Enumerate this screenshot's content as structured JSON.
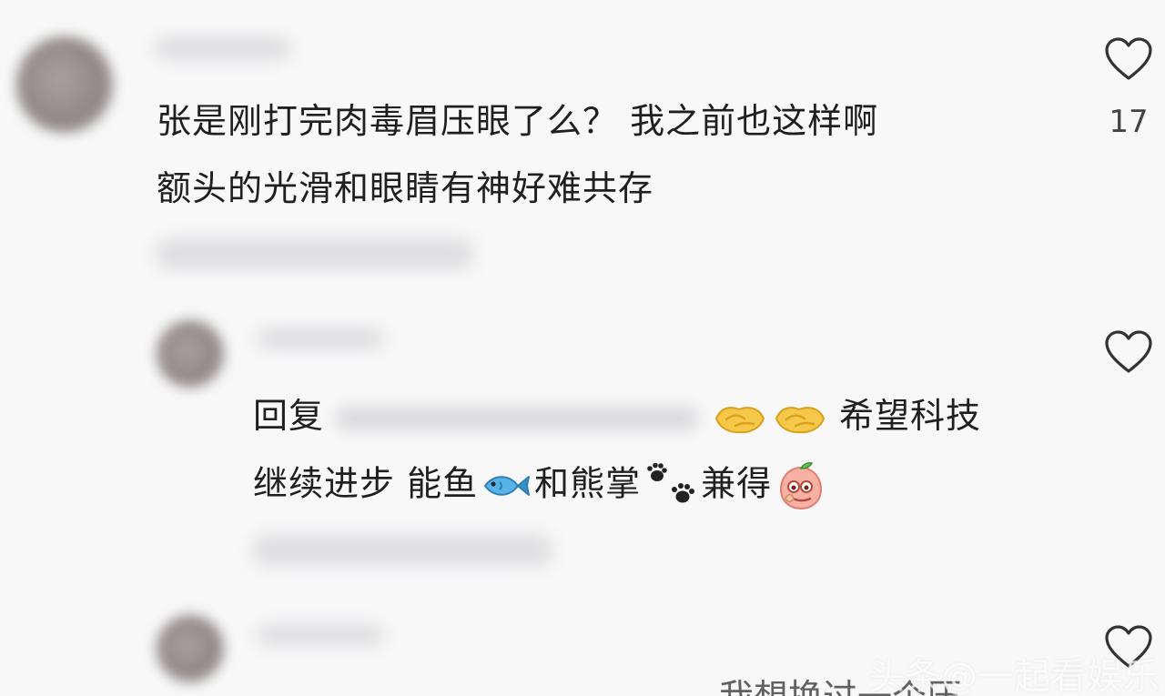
{
  "comment1": {
    "line1": "张是刚打完肉毒眉压眼了么？ 我之前也这样啊",
    "line2": "额头的光滑和眼睛有神好难共存",
    "likes": "17",
    "heart_icon": "heart-outline-icon"
  },
  "reply": {
    "prefix": "回复",
    "after_blur": "希望科技",
    "line2_part1": "继续进步 能鱼",
    "line2_part2": "和熊掌",
    "line2_part3": "兼得",
    "emojis": [
      "handshake-emoji",
      "handshake-emoji",
      "fish-emoji",
      "paw-prints-emoji",
      "peach-face-emoji"
    ],
    "heart_icon": "heart-outline-icon"
  },
  "comment3": {
    "heart_icon": "heart-outline-icon",
    "partial_text": "我想换过一个压"
  },
  "watermark": "头条@一起看娱乐"
}
